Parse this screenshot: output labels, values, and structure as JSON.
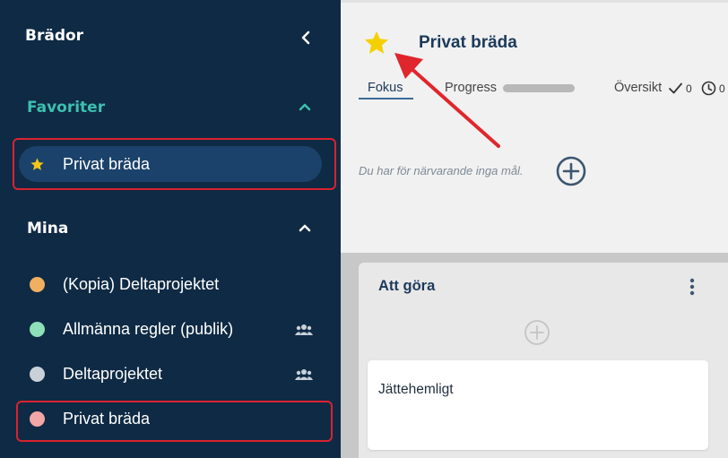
{
  "sidebar": {
    "title": "Brädor",
    "favorites": {
      "heading": "Favoriter",
      "heading_color": "#3cc0b0",
      "items": [
        {
          "label": "Privat bräda",
          "star_color": "#f5c518"
        }
      ]
    },
    "mine": {
      "heading": "Mina",
      "items": [
        {
          "label": "(Kopia) Deltaprojektet",
          "dot_color": "#f0b060",
          "shared": false
        },
        {
          "label": "Allmänna regler (publik)",
          "dot_color": "#8de0b8",
          "shared": true
        },
        {
          "label": "Deltaprojektet",
          "dot_color": "#c9d0d8",
          "shared": true
        },
        {
          "label": "Privat bräda",
          "dot_color": "#f4a6a6",
          "shared": false
        }
      ]
    }
  },
  "board": {
    "title": "Privat bräda",
    "favorite": true,
    "tabs": {
      "focus": "Fokus",
      "progress": "Progress",
      "overview": "Översikt"
    },
    "overview_counts": {
      "done": "0",
      "pending": "0"
    },
    "goals_empty_text": "Du har för närvarande inga mål."
  },
  "columns": [
    {
      "title": "Att göra",
      "cards": [
        {
          "title": "Jättehemligt"
        }
      ]
    }
  ],
  "colors": {
    "sidebar_bg": "#0f2a44",
    "active_item_bg": "#1b426a",
    "highlight_red": "#d9232e",
    "star_yellow": "#f5d000"
  }
}
